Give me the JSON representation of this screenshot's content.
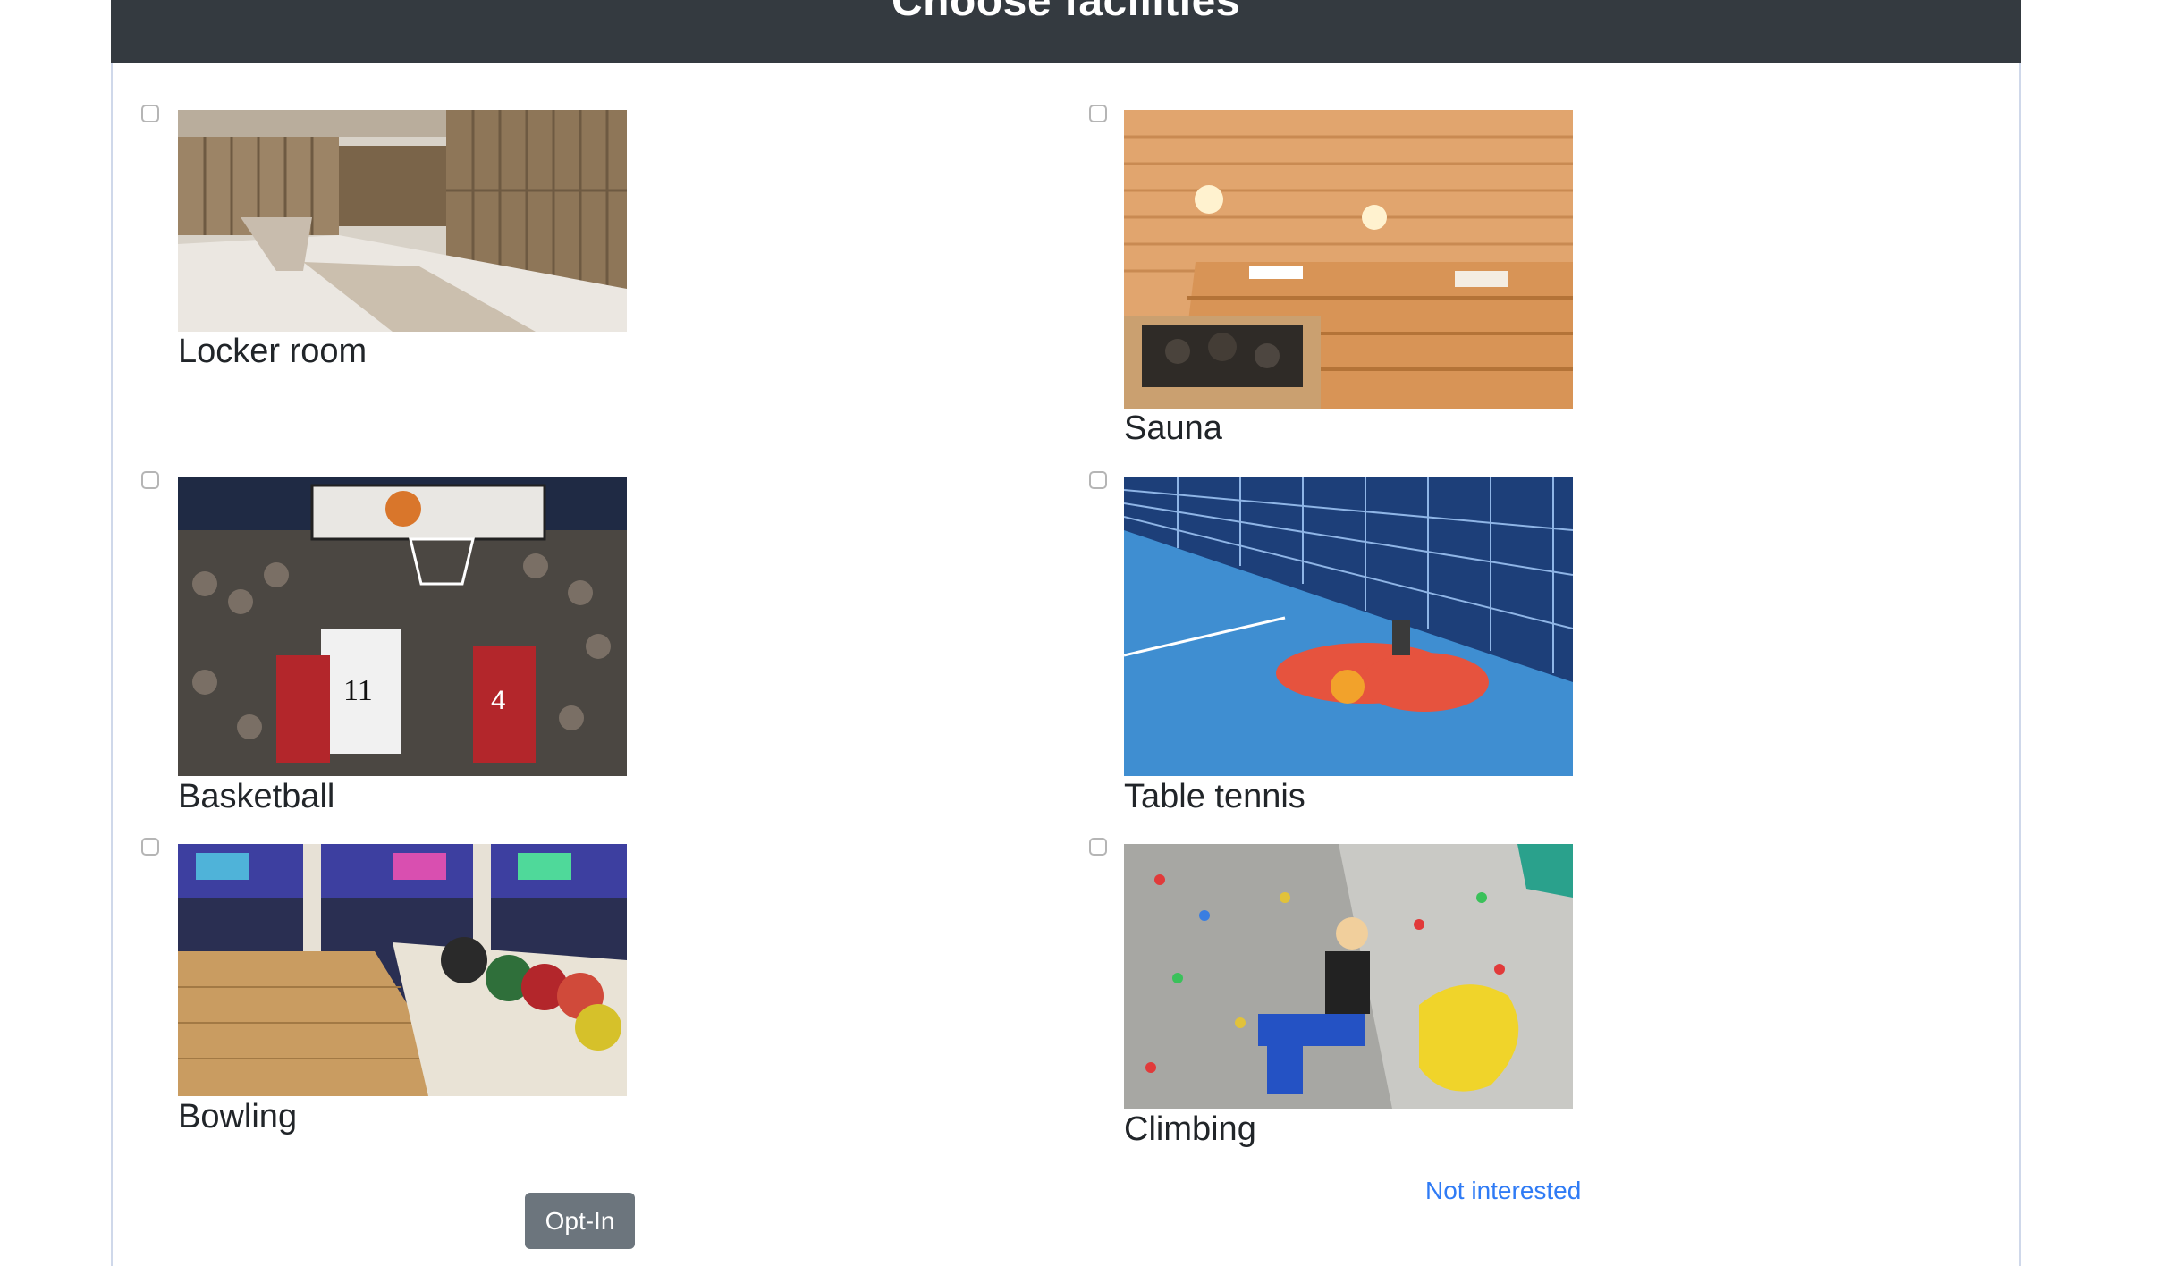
{
  "header": {
    "title": "Choose facilities"
  },
  "facilities": [
    {
      "label": "Locker room",
      "image": "locker-room-photo",
      "checked": false
    },
    {
      "label": "Sauna",
      "image": "sauna-photo",
      "checked": false
    },
    {
      "label": "Basketball",
      "image": "basketball-photo",
      "checked": false
    },
    {
      "label": "Table tennis",
      "image": "table-tennis-photo",
      "checked": false
    },
    {
      "label": "Bowling",
      "image": "bowling-photo",
      "checked": false
    },
    {
      "label": "Climbing",
      "image": "climbing-photo",
      "checked": false
    }
  ],
  "actions": {
    "opt_in_label": "Opt-In",
    "not_interested_label": "Not interested"
  },
  "colors": {
    "header_bg": "#343a40",
    "button_bg": "#6c757d",
    "link": "#2f7bf5"
  }
}
